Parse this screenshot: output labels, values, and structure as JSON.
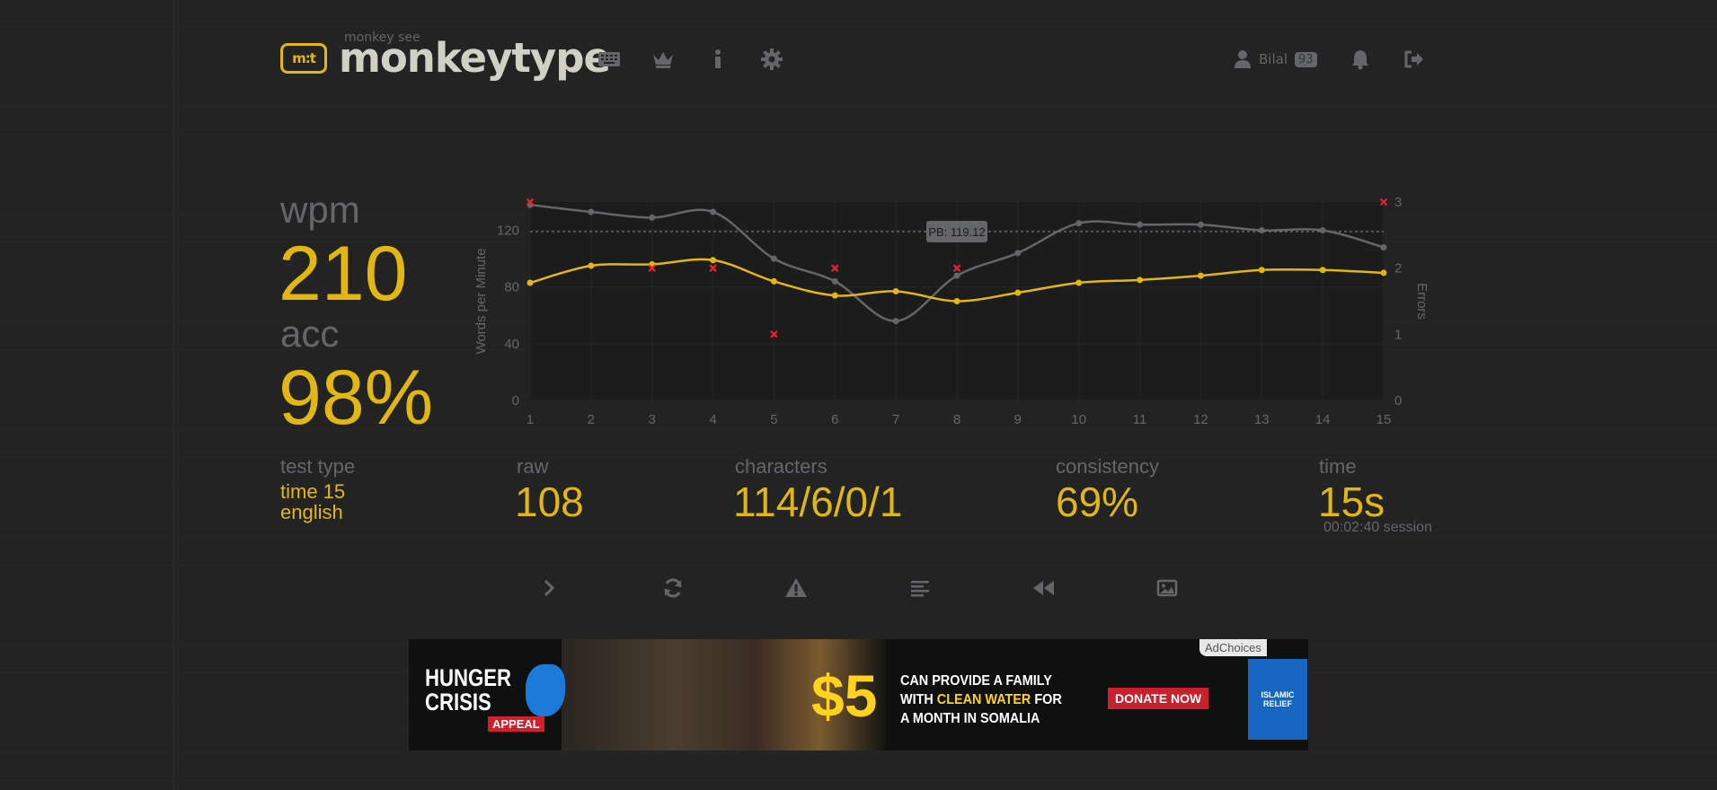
{
  "header": {
    "logo_small": "monkey see",
    "logo_text": "monkeytype",
    "logo_icon": "keyboard-logo",
    "nav": [
      {
        "name": "keyboard-icon"
      },
      {
        "name": "crown-icon"
      },
      {
        "name": "info-icon"
      },
      {
        "name": "gear-icon"
      }
    ],
    "username": "Bilal",
    "level": "93"
  },
  "stats": {
    "wpm_label": "wpm",
    "wpm": "210",
    "acc_label": "acc",
    "acc": "98%",
    "test_type_label": "test type",
    "test_type_line1": "time 15",
    "test_type_line2": "english",
    "raw_label": "raw",
    "raw": "108",
    "characters_label": "characters",
    "characters": "114/6/0/1",
    "consistency_label": "consistency",
    "consistency": "69%",
    "time_label": "time",
    "time": "15s",
    "session": "00:02:40 session"
  },
  "chart_data": {
    "type": "line",
    "x": [
      1,
      2,
      3,
      4,
      5,
      6,
      7,
      8,
      9,
      10,
      11,
      12,
      13,
      14,
      15
    ],
    "ylabel": "Words per Minute",
    "y2label": "Errors",
    "ylim": [
      0,
      140
    ],
    "y2lim": [
      0,
      3
    ],
    "yticks": [
      0,
      40,
      80,
      120
    ],
    "y2ticks": [
      0,
      1,
      2,
      3
    ],
    "pb_line": 119.12,
    "pb_label": "PB: 119.12",
    "colors": {
      "raw": "#646669",
      "wpm": "#e2b714",
      "errors": "#ca4754"
    },
    "series": [
      {
        "key": "raw",
        "values": [
          138,
          133,
          129,
          133,
          100,
          84,
          56,
          88,
          104,
          125,
          124,
          124,
          120,
          120,
          108
        ]
      },
      {
        "key": "wpm",
        "values": [
          83,
          95,
          96,
          99,
          84,
          74,
          77,
          70,
          76,
          83,
          85,
          88,
          92,
          92,
          90
        ]
      },
      {
        "key": "errors",
        "x": [
          1,
          3,
          4,
          5,
          6,
          8,
          15
        ],
        "values": [
          3,
          2,
          2,
          1,
          2,
          2,
          3
        ]
      }
    ]
  },
  "actions": [
    {
      "name": "next-test-button",
      "icon": "chevron-right-icon"
    },
    {
      "name": "restart-button",
      "icon": "refresh-icon"
    },
    {
      "name": "practice-words-button",
      "icon": "warning-icon"
    },
    {
      "name": "words-history-button",
      "icon": "align-left-icon"
    },
    {
      "name": "replay-button",
      "icon": "backward-icon"
    },
    {
      "name": "screenshot-button",
      "icon": "image-icon"
    }
  ],
  "ad": {
    "hunger_line1": "HUNGER",
    "hunger_line2": "CRISIS",
    "appeal": "APPEAL",
    "price": "$5",
    "msg_line1": "CAN PROVIDE A FAMILY",
    "msg_line2_a": "WITH ",
    "msg_line2_b": "CLEAN WATER",
    "msg_line2_c": " FOR",
    "msg_line3": "A MONTH IN SOMALIA",
    "donate": "DONATE NOW",
    "logo_text": "ISLAMIC RELIEF",
    "choices": "AdChoices"
  }
}
